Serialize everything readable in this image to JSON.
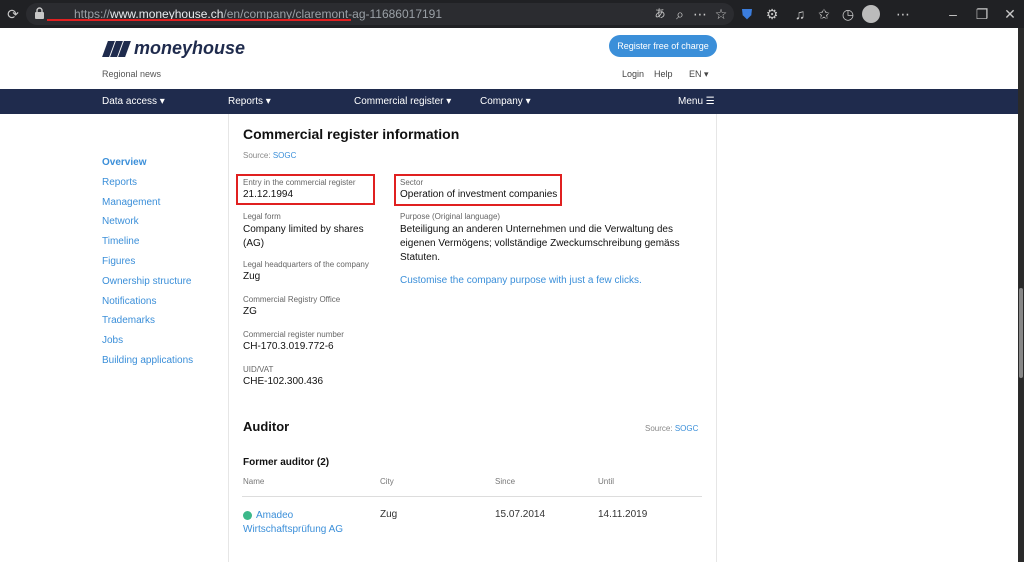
{
  "browser": {
    "url_prefix": "https://",
    "url_domain": "www.moneyhouse.ch",
    "url_path": "/en/company/claremont-ag-11686017191"
  },
  "header": {
    "logo_text": "moneyhouse",
    "regional_news": "Regional news",
    "register_button": "Register free of charge",
    "login": "Login",
    "help": "Help",
    "language": "EN ▾"
  },
  "nav": {
    "data_access": "Data access ▾",
    "reports": "Reports ▾",
    "commercial_register": "Commercial register ▾",
    "company": "Company ▾",
    "menu": "Menu ☰"
  },
  "sidebar": {
    "items": [
      "Overview",
      "Reports",
      "Management",
      "Network",
      "Timeline",
      "Figures",
      "Ownership structure",
      "Notifications",
      "Trademarks",
      "Jobs",
      "Building applications"
    ]
  },
  "register_info": {
    "title": "Commercial register information",
    "source_label": "Source:",
    "source_link": "SOGC",
    "entry_label": "Entry in the commercial register",
    "entry_value": "21.12.1994",
    "legal_form_label": "Legal form",
    "legal_form_value": "Company limited by shares (AG)",
    "hq_label": "Legal headquarters of the company",
    "hq_value": "Zug",
    "office_label": "Commercial Registry Office",
    "office_value": "ZG",
    "number_label": "Commercial register number",
    "number_value": "CH-170.3.019.772-6",
    "uid_label": "UID/VAT",
    "uid_value": "CHE-102.300.436",
    "sector_label": "Sector",
    "sector_value": "Operation of investment companies",
    "purpose_label": "Purpose (Original language)",
    "purpose_value": "Beteiligung an anderen Unternehmen und die Verwaltung des eigenen Vermögens; vollständige Zweckumschreibung gemäss Statuten.",
    "customise_link": "Customise the company purpose with just a few clicks."
  },
  "auditor": {
    "title": "Auditor",
    "source_label": "Source:",
    "source_link": "SOGC",
    "former_title": "Former auditor (2)",
    "columns": [
      "Name",
      "City",
      "Since",
      "Until"
    ],
    "rows": [
      {
        "name": "Amadeo Wirtschaftsprüfung AG",
        "city": "Zug",
        "since": "15.07.2014",
        "until": "14.11.2019"
      }
    ]
  },
  "icons": {
    "reload": "reload-icon",
    "lock": "lock-icon",
    "accent": "#3b8fd9",
    "navbar": "#1f2b4d",
    "highlight": "#e02020"
  }
}
